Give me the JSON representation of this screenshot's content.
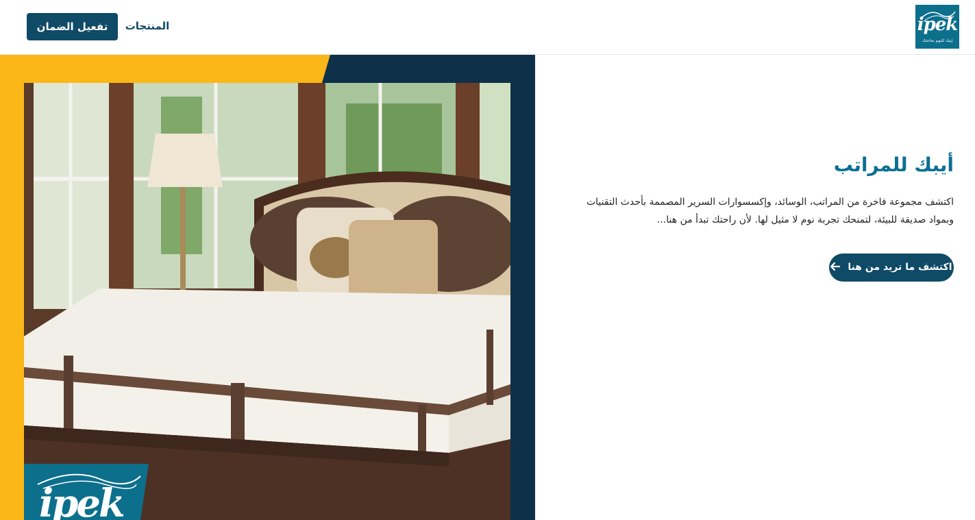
{
  "header": {
    "logo_text": "ipek",
    "logo_subtext": "إيبك للنوم بحاجتك",
    "nav_products": "المنتجات",
    "warranty_button": "تفعيل الضمان"
  },
  "hero": {
    "title": "أيبك للمراتب",
    "description": "اكتشف مجموعة فاخرة من المراتب، الوسائد، وإكسسوارات السرير المصممة بأحدث التقنيات وبمواد صديقة للبيئة، لتمنحك تجربة نوم لا مثيل لها. لأن راحتك تبدأ من هنا...",
    "cta_label": "اكتشف ما تريد من هنا",
    "cta_icon": "arrow-left-icon",
    "image_badge_text": "ipek"
  },
  "colors": {
    "brand_navy": "#0f4a66",
    "brand_teal": "#0c6f8c",
    "accent_yellow": "#fbb717",
    "title_blue": "#0d6f93"
  }
}
